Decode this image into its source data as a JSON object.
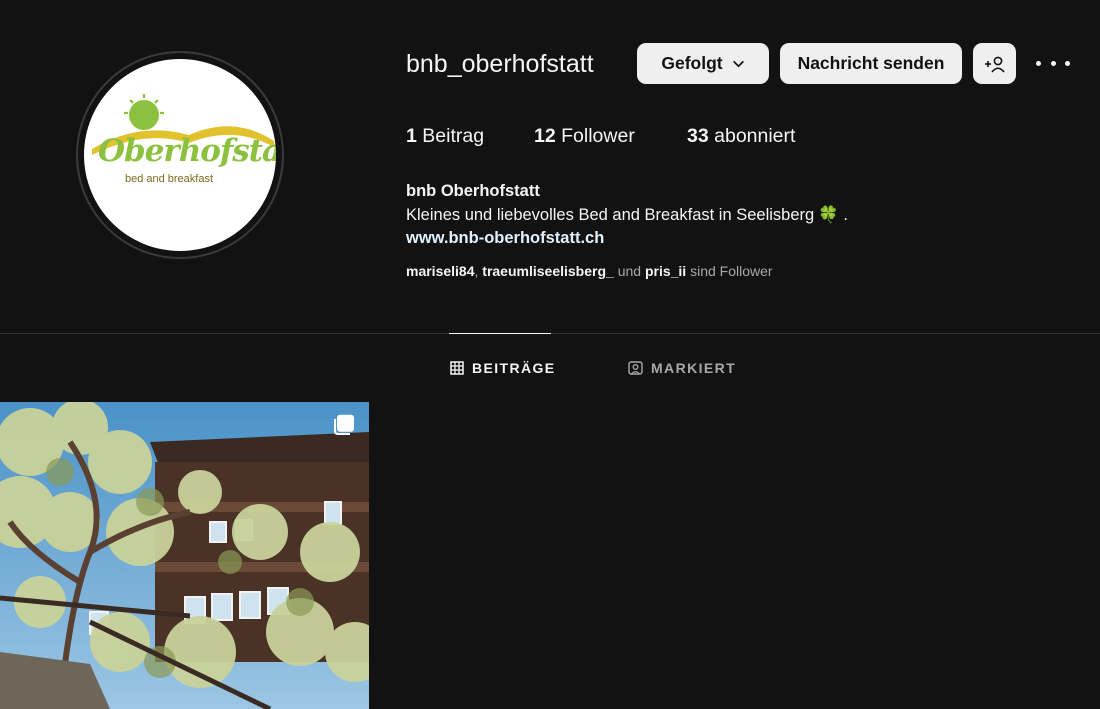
{
  "profile": {
    "username": "bnb_oberhofstatt",
    "avatar_logo": {
      "word": "Oberhofstatt",
      "tagline": "bed and breakfast"
    },
    "buttons": {
      "follow_label": "Gefolgt",
      "follow_icon": "chevron-down-icon",
      "message_label": "Nachricht senden",
      "add_user_icon": "add-user-icon",
      "more_icon": "more-options-icon"
    },
    "stats": [
      {
        "count": "1",
        "label": "Beitrag"
      },
      {
        "count": "12",
        "label": "Follower"
      },
      {
        "count": "33",
        "label": "abonniert"
      }
    ],
    "bio": {
      "name": "bnb Oberhofstatt",
      "text": "Kleines und liebevolles Bed and Breakfast in Seelisberg",
      "emoji": "🍀",
      "trailing": ".",
      "website": "www.bnb-oberhofstatt.ch"
    },
    "followed_by": {
      "users": [
        "mariseli84",
        "traeumliseelisberg_",
        "pris_ii"
      ],
      "separator": ",",
      "and_text": "und",
      "suffix": "sind Follower"
    }
  },
  "tabs": [
    {
      "label": "BEITRÄGE",
      "icon": "grid-icon",
      "active": true
    },
    {
      "label": "MARKIERT",
      "icon": "tagged-icon",
      "active": false
    }
  ],
  "posts": [
    {
      "type": "carousel",
      "icon": "multiple-images-icon"
    }
  ],
  "colors": {
    "background": "#121212",
    "text": "#f5f5f5",
    "muted": "#a8a8a8",
    "button_bg": "#efefef",
    "link": "#e0f1ff",
    "logo_green": "#8cc13f",
    "logo_yellow": "#e1c22c"
  }
}
